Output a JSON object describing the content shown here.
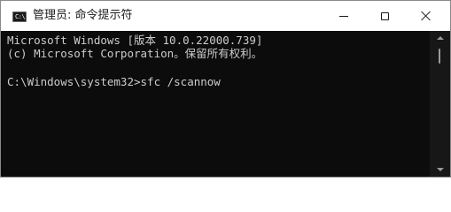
{
  "window": {
    "title": "管理员: 命令提示符",
    "icon": "cmd-icon",
    "icon_glyph": "C:\\"
  },
  "controls": {
    "minimize_icon": "minimize-icon",
    "maximize_icon": "maximize-icon",
    "close_icon": "close-icon"
  },
  "console": {
    "lines": [
      "Microsoft Windows [版本 10.0.22000.739]",
      "(c) Microsoft Corporation。保留所有权利。",
      "C:\\Windows\\system32>sfc /scannow"
    ]
  },
  "colors": {
    "console_bg": "#0c0c0c",
    "console_text": "#cccccc",
    "titlebar_bg": "#ffffff"
  }
}
